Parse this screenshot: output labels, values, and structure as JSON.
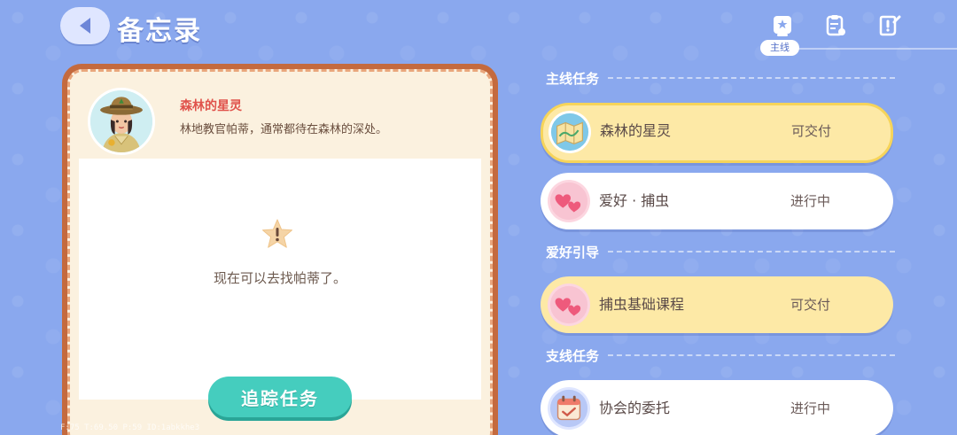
{
  "header": {
    "title": "备忘录",
    "active_tab_label": "主线",
    "tabs": [
      {
        "icon": "quest-book-icon"
      },
      {
        "icon": "clipboard-icon"
      },
      {
        "icon": "note-edit-icon"
      }
    ]
  },
  "npc": {
    "name": "森林的星灵",
    "description": "林地教官帕蒂，通常都待在森林的深处。"
  },
  "detail": {
    "message": "现在可以去找帕蒂了。",
    "track_button": "追踪任务"
  },
  "debug": "F:75  T:69.50  P:59  ID:1abkkhe3",
  "sections": [
    {
      "title": "主线任务",
      "quests": [
        {
          "name": "森林的星灵",
          "status": "可交付",
          "icon": "map-icon",
          "state": "selected"
        }
      ]
    },
    {
      "title": "",
      "quests": [
        {
          "name": "爱好 · 捕虫",
          "status": "进行中",
          "icon": "heart-icon",
          "state": "normal"
        }
      ]
    },
    {
      "title": "爱好引导",
      "quests": [
        {
          "name": "捕虫基础课程",
          "status": "可交付",
          "icon": "heart-icon",
          "state": "deliver"
        }
      ]
    },
    {
      "title": "支线任务",
      "quests": [
        {
          "name": "协会的委托",
          "status": "进行中",
          "icon": "calendar-icon",
          "state": "normal"
        }
      ]
    }
  ],
  "colors": {
    "background": "#8aa8ee",
    "accent_teal": "#45cdbe",
    "deliverable_yellow": "#fde9a6",
    "npc_name_red": "#e0524b"
  }
}
